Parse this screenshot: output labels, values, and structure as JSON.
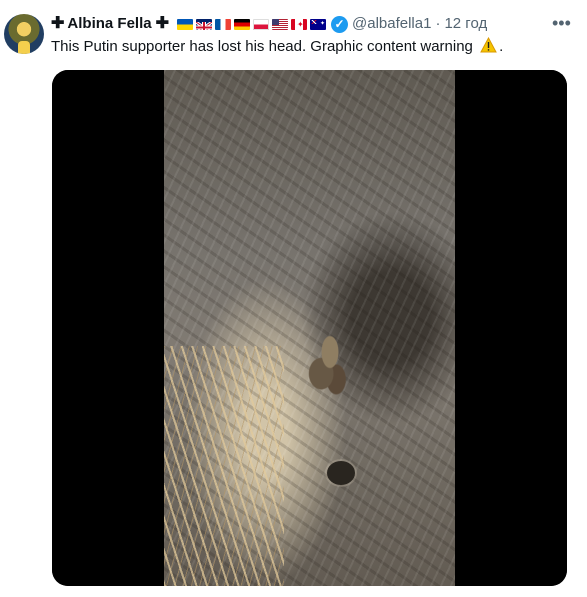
{
  "author": {
    "display_name": "Albina Fella",
    "prefix_symbol": "✚",
    "suffix_symbol": "✚",
    "flags": [
      "ukraine-flag",
      "uk-flag",
      "france-flag",
      "germany-flag",
      "poland-flag",
      "usa-flag",
      "canada-flag",
      "australia-flag"
    ],
    "verified_icon": "verified-badge-icon",
    "handle": "@albafella1",
    "separator": "·",
    "time": "12 год"
  },
  "post": {
    "text_before": "This Putin supporter has lost his head. Graphic content warning ",
    "warning_icon": "warning-icon",
    "text_after": "."
  },
  "actions": {
    "more_icon": "more-icon",
    "more_label": "•••"
  },
  "media": {
    "type": "video-still",
    "accent_bg": "#000000"
  },
  "colors": {
    "text": "#0f1419",
    "muted": "#536471",
    "verified": "#1d9bf0"
  }
}
